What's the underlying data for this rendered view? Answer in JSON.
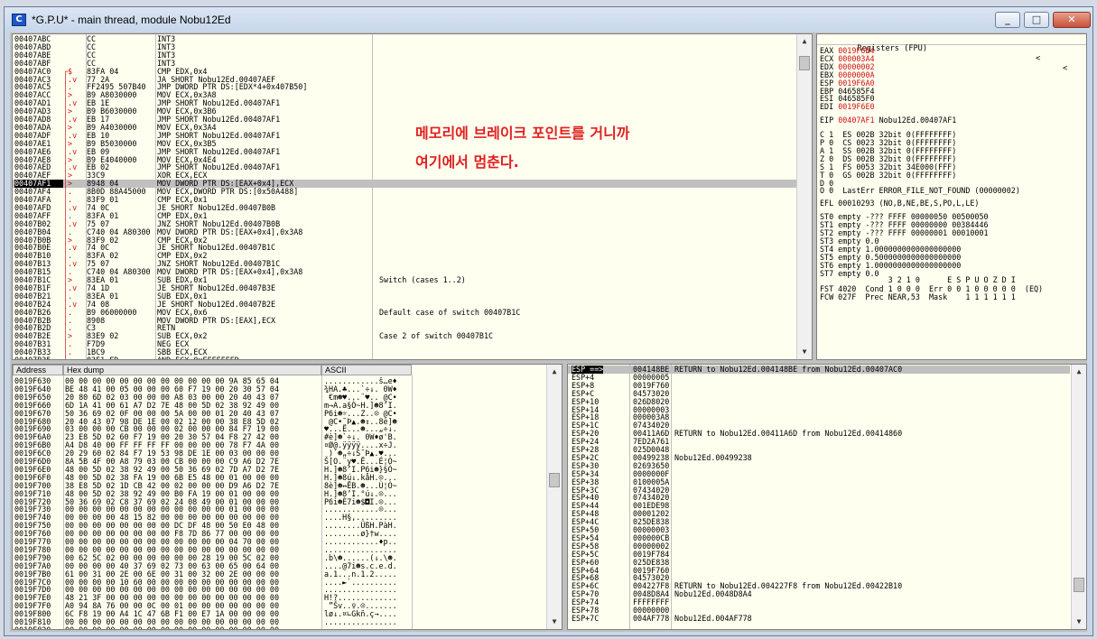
{
  "window": {
    "title": "*G.P.U* - main thread, module Nobu12Ed",
    "icon_label": "C",
    "minimize": "_",
    "maximize": "□",
    "close": "✕"
  },
  "cpu": {
    "rows": [
      {
        "addr": "00407ABC",
        "jmp": "",
        "hex": "CC",
        "asm": "INT3",
        "com": ""
      },
      {
        "addr": "00407ABD",
        "jmp": "",
        "hex": "CC",
        "asm": "INT3",
        "com": ""
      },
      {
        "addr": "00407ABE",
        "jmp": "",
        "hex": "CC",
        "asm": "INT3",
        "com": ""
      },
      {
        "addr": "00407ABF",
        "jmp": "",
        "hex": "CC",
        "asm": "INT3",
        "com": ""
      },
      {
        "addr": "00407AC0",
        "jmp": "┌$",
        "hex": "83FA 04",
        "asm": "CMP EDX,0x4",
        "com": ""
      },
      {
        "addr": "00407AC3",
        "jmp": "│.v",
        "hex": "77 2A",
        "asm": "JA SHORT Nobu12Ed.00407AEF",
        "com": ""
      },
      {
        "addr": "00407AC5",
        "jmp": "│.",
        "hex": "FF2495 507B40",
        "asm": "JMP DWORD PTR DS:[EDX*4+0x407B50]",
        "com": ""
      },
      {
        "addr": "00407ACC",
        "jmp": "│>",
        "hex": "B9 A8030000",
        "asm": "MOV ECX,0x3A8",
        "com": ""
      },
      {
        "addr": "00407AD1",
        "jmp": "│.v",
        "hex": "EB 1E",
        "asm": "JMP SHORT Nobu12Ed.00407AF1",
        "com": ""
      },
      {
        "addr": "00407AD3",
        "jmp": "│>",
        "hex": "B9 B6030000",
        "asm": "MOV ECX,0x3B6",
        "com": ""
      },
      {
        "addr": "00407AD8",
        "jmp": "│.v",
        "hex": "EB 17",
        "asm": "JMP SHORT Nobu12Ed.00407AF1",
        "com": ""
      },
      {
        "addr": "00407ADA",
        "jmp": "│>",
        "hex": "B9 A4030000",
        "asm": "MOV ECX,0x3A4",
        "com": ""
      },
      {
        "addr": "00407ADF",
        "jmp": "│.v",
        "hex": "EB 10",
        "asm": "JMP SHORT Nobu12Ed.00407AF1",
        "com": ""
      },
      {
        "addr": "00407AE1",
        "jmp": "│>",
        "hex": "B9 B5030000",
        "asm": "MOV ECX,0x3B5",
        "com": ""
      },
      {
        "addr": "00407AE6",
        "jmp": "│.v",
        "hex": "EB 09",
        "asm": "JMP SHORT Nobu12Ed.00407AF1",
        "com": ""
      },
      {
        "addr": "00407AE8",
        "jmp": "│>",
        "hex": "B9 E4040000",
        "asm": "MOV ECX,0x4E4",
        "com": ""
      },
      {
        "addr": "00407AED",
        "jmp": "│.v",
        "hex": "EB 02",
        "asm": "JMP SHORT Nobu12Ed.00407AF1",
        "com": ""
      },
      {
        "addr": "00407AEF",
        "jmp": "│>",
        "hex": "33C9",
        "asm": "XOR ECX,ECX",
        "com": ""
      },
      {
        "addr": "00407AF1",
        "jmp": "│>",
        "hex": "8948 04",
        "asm": "MOV DWORD PTR DS:[EAX+0x4],ECX",
        "com": ""
      },
      {
        "addr": "00407AF4",
        "jmp": "│.",
        "hex": "8B0D 88A45000",
        "asm": "MOV ECX,DWORD PTR DS:[0x50A488]",
        "com": ""
      },
      {
        "addr": "00407AFA",
        "jmp": "│.",
        "hex": "83F9 01",
        "asm": "CMP ECX,0x1",
        "com": ""
      },
      {
        "addr": "00407AFD",
        "jmp": "│.v",
        "hex": "74 0C",
        "asm": "JE SHORT Nobu12Ed.00407B0B",
        "com": ""
      },
      {
        "addr": "00407AFF",
        "jmp": "│.",
        "hex": "83FA 01",
        "asm": "CMP EDX,0x1",
        "com": ""
      },
      {
        "addr": "00407B02",
        "jmp": "│.v",
        "hex": "75 07",
        "asm": "JNZ SHORT Nobu12Ed.00407B0B",
        "com": ""
      },
      {
        "addr": "00407B04",
        "jmp": "│.",
        "hex": "C740 04 A80300",
        "asm": "MOV DWORD PTR DS:[EAX+0x4],0x3A8",
        "com": ""
      },
      {
        "addr": "00407B0B",
        "jmp": "│>",
        "hex": "83F9 02",
        "asm": "CMP ECX,0x2",
        "com": ""
      },
      {
        "addr": "00407B0E",
        "jmp": "│.v",
        "hex": "74 0C",
        "asm": "JE SHORT Nobu12Ed.00407B1C",
        "com": ""
      },
      {
        "addr": "00407B10",
        "jmp": "│.",
        "hex": "83FA 02",
        "asm": "CMP EDX,0x2",
        "com": ""
      },
      {
        "addr": "00407B13",
        "jmp": "│.v",
        "hex": "75 07",
        "asm": "JNZ SHORT Nobu12Ed.00407B1C",
        "com": ""
      },
      {
        "addr": "00407B15",
        "jmp": "│.",
        "hex": "C740 04 A80300",
        "asm": "MOV DWORD PTR DS:[EAX+0x4],0x3A8",
        "com": ""
      },
      {
        "addr": "00407B1C",
        "jmp": "│>",
        "hex": "83EA 01",
        "asm": "SUB EDX,0x1",
        "com": "Switch (cases 1..2)"
      },
      {
        "addr": "00407B1F",
        "jmp": "│.v",
        "hex": "74 1D",
        "asm": "JE SHORT Nobu12Ed.00407B3E",
        "com": ""
      },
      {
        "addr": "00407B21",
        "jmp": "│.",
        "hex": "83EA 01",
        "asm": "SUB EDX,0x1",
        "com": ""
      },
      {
        "addr": "00407B24",
        "jmp": "│.v",
        "hex": "74 08",
        "asm": "JE SHORT Nobu12Ed.00407B2E",
        "com": ""
      },
      {
        "addr": "00407B26",
        "jmp": "│.",
        "hex": "B9 06000000",
        "asm": "MOV ECX,0x6",
        "com": "Default case of switch 00407B1C"
      },
      {
        "addr": "00407B2B",
        "jmp": "│.",
        "hex": "8908",
        "asm": "MOV DWORD PTR DS:[EAX],ECX",
        "com": ""
      },
      {
        "addr": "00407B2D",
        "jmp": "│.",
        "hex": "C3",
        "asm": "RETN",
        "com": ""
      },
      {
        "addr": "00407B2E",
        "jmp": "│>",
        "hex": "83E9 02",
        "asm": "SUB ECX,0x2",
        "com": "Case 2 of switch 00407B1C"
      },
      {
        "addr": "00407B31",
        "jmp": "│.",
        "hex": "F7D9",
        "asm": "NEG ECX",
        "com": ""
      },
      {
        "addr": "00407B33",
        "jmp": "│.",
        "hex": "1BC9",
        "asm": "SBB ECX,ECX",
        "com": ""
      },
      {
        "addr": "00407B35",
        "jmp": "│.",
        "hex": "83E1 FD",
        "asm": "AND ECX,0xFFFFFFFD",
        "com": ""
      }
    ],
    "annotation_line1": "메모리에 브레이크 포인트를 거니까",
    "annotation_line2": "여기에서 멈춘다."
  },
  "registers": {
    "header": "Registers (FPU)",
    "nav_left": "<",
    "nav_right": "<",
    "general": [
      {
        "name": "EAX",
        "value": "0019F6B4",
        "desc": ""
      },
      {
        "name": "ECX",
        "value": "000003A4",
        "desc": ""
      },
      {
        "name": "EDX",
        "value": "00000002",
        "desc": ""
      },
      {
        "name": "EBX",
        "value": "0000000A",
        "desc": ""
      },
      {
        "name": "ESP",
        "value": "0019F6A0",
        "desc": ""
      },
      {
        "name": "EBP",
        "value": "046585F4",
        "desc": ""
      },
      {
        "name": "ESI",
        "value": "046585F0",
        "desc": ""
      },
      {
        "name": "EDI",
        "value": "0019F6E0",
        "desc": ""
      }
    ],
    "eip": {
      "name": "EIP",
      "value": "00407AF1",
      "desc": "Nobu12Ed.00407AF1"
    },
    "flags": [
      "C 1  ES 002B 32bit 0(FFFFFFFF)",
      "P 0  CS 0023 32bit 0(FFFFFFFF)",
      "A 1  SS 002B 32bit 0(FFFFFFFF)",
      "Z 0  DS 002B 32bit 0(FFFFFFFF)",
      "S 1  FS 0053 32bit 34E000(FFF)",
      "T 0  GS 002B 32bit 0(FFFFFFFF)",
      "D 0",
      "O 0  LastErr ERROR_FILE_NOT_FOUND (00000002)"
    ],
    "efl": "EFL 00010293 (NO,B,NE,BE,S,PO,L,LE)",
    "fpu": [
      "ST0 empty -??? FFFF 00000050 00500050",
      "ST1 empty -??? FFFF 00000000 00384446",
      "ST2 empty -??? FFFF 00000001 00010001",
      "ST3 empty 0.0",
      "ST4 empty 1.0000000000000000000",
      "ST5 empty 0.5000000000000000000",
      "ST6 empty 1.0000000000000000000",
      "ST7 empty 0.0"
    ],
    "fst_header": "               3 2 1 0      E S P U O Z D I",
    "fst": "FST 4020  Cond 1 0 0 0  Err 0 0 1 0 0 0 0 0  (EQ)",
    "fcw": "FCW 027F  Prec NEAR,53  Mask    1 1 1 1 1 1"
  },
  "dump": {
    "col_address": "Address",
    "col_hex": "Hex dump",
    "col_ascii": "ASCII",
    "rows": [
      {
        "addr": "0019F630",
        "hex": "00 00 00 00 00 00 00 00 00 00 00 00 9A 85 65 04",
        "asc": "............š…e♦"
      },
      {
        "addr": "0019F640",
        "hex": "BE 48 41 00 05 00 00 00 60 F7 19 00 20 30 57 04",
        "asc": "¾HA.♣...`÷↓. 0W♦"
      },
      {
        "addr": "0019F650",
        "hex": "20 80 6D 02 03 00 00 00 A8 03 00 00 20 40 43 07",
        "asc": " €m☻♥...¨♥.. @C•"
      },
      {
        "addr": "0019F660",
        "hex": "6D 1A 41 00 61 A7 D2 7E 48 00 5D 02 38 92 49 00",
        "asc": "m→A.a§Ò~H.]☻8’I."
      },
      {
        "addr": "0019F670",
        "hex": "50 36 69 02 0F 00 00 00 5A 00 00 01 20 40 43 07",
        "asc": "P6i☻☼...Z..☺ @C•"
      },
      {
        "addr": "0019F680",
        "hex": "20 40 43 07 98 DE 1E 00 02 12 00 00 38 E8 5D 02",
        "asc": " @C•˜Þ▲.☻↕..8è]☻"
      },
      {
        "addr": "0019F690",
        "hex": "03 00 00 00 CB 00 00 00 02 00 00 00 84 F7 19 00",
        "asc": "♥...Ë...☻...„÷↓."
      },
      {
        "addr": "0019F6A0",
        "hex": "23 E8 5D 02 60 F7 19 00 20 30 57 04 F8 27 42 00",
        "asc": "#è]☻`÷↓. 0W♦ø'B."
      },
      {
        "addr": "0019F6B0",
        "hex": "A4 D8 40 00 FF FF FF FF 00 00 00 00 78 F7 4A 00",
        "asc": "¤Ø@.ÿÿÿÿ....x÷J."
      },
      {
        "addr": "0019F6C0",
        "hex": "20 29 60 02 84 F7 19 53 98 DE 1E 00 03 00 00 00",
        "asc": " )`☻„÷↓S˜Þ▲.♥..."
      },
      {
        "addr": "0019F6D0",
        "hex": "8A 5B 4F 00 A8 79 03 00 CB 00 00 00 C9 A6 D2 7E",
        "asc": "Š[O.¨y♥.Ë...É¦Ò~"
      },
      {
        "addr": "0019F6E0",
        "hex": "48 00 5D 02 38 92 49 00 50 36 69 02 7D A7 D2 7E",
        "asc": "H.]☻8’I.P6i☻}§Ò~"
      },
      {
        "addr": "0019F6F0",
        "hex": "48 00 5D 02 38 FA 19 00 6B E5 48 00 01 00 00 00",
        "asc": "H.]☻8ú↓.kåH.☺..."
      },
      {
        "addr": "0019F700",
        "hex": "38 E8 5D 02 1D CB 42 00 02 00 00 00 D9 A6 D2 7E",
        "asc": "8è]☻↔ËB.☻...Ù¦Ò~"
      },
      {
        "addr": "0019F710",
        "hex": "48 00 5D 02 38 92 49 00 B0 FA 19 00 01 00 00 00",
        "asc": "H.]☻8’I.°ú↓.☺..."
      },
      {
        "addr": "0019F720",
        "hex": "50 36 69 02 C8 37 69 02 24 08 49 00 01 00 00 00",
        "asc": "P6i☻È7i☻$◘I.☺..."
      },
      {
        "addr": "0019F730",
        "hex": "00 00 00 00 00 00 00 00 00 00 00 00 01 00 00 00",
        "asc": "............☺..."
      },
      {
        "addr": "0019F740",
        "hex": "00 00 00 00 48 15 82 00 00 00 00 00 00 00 00 00",
        "asc": "....H§‚........."
      },
      {
        "addr": "0019F750",
        "hex": "00 00 00 00 00 00 00 00 DC DF 48 00 50 E0 48 00",
        "asc": "........ÜßH.PàH."
      },
      {
        "addr": "0019F760",
        "hex": "00 00 00 00 00 00 00 00 F8 7D 86 77 00 00 00 00",
        "asc": "........ø}†w...."
      },
      {
        "addr": "0019F770",
        "hex": "00 00 00 00 00 00 00 00 00 00 00 00 04 70 00 00",
        "asc": "............♦p.."
      },
      {
        "addr": "0019F780",
        "hex": "00 00 00 00 00 00 00 00 00 00 00 00 00 00 00 00",
        "asc": "................"
      },
      {
        "addr": "0019F790",
        "hex": "00 62 5C 02 00 00 00 00 00 00 28 19 00 5C 02 00",
        "asc": ".b\\☻......(↓.\\☻."
      },
      {
        "addr": "0019F7A0",
        "hex": "00 00 00 00 40 37 69 02 73 00 63 00 65 00 64 00",
        "asc": "....@7i☻s.c.e.d."
      },
      {
        "addr": "0019F7B0",
        "hex": "61 00 31 00 2E 00 6E 00 31 00 32 00 2E 00 00 00",
        "asc": "a.1...n.1.2....."
      },
      {
        "addr": "0019F7C0",
        "hex": "00 00 00 00 10 60 00 00 00 00 00 00 00 00 00 00",
        "asc": "....►`.........."
      },
      {
        "addr": "0019F7D0",
        "hex": "00 00 00 00 00 00 00 00 00 00 00 00 00 00 00 00",
        "asc": "................"
      },
      {
        "addr": "0019F7E0",
        "hex": "48 21 3F 00 00 00 00 00 00 00 00 00 00 00 00 00",
        "asc": "H!?............."
      },
      {
        "addr": "0019F7F0",
        "hex": "A0 94 8A 76 00 00 0C 00 01 00 00 00 00 00 00 00",
        "asc": " ”Šv..♀.☺......."
      },
      {
        "addr": "0019F800",
        "hex": "6C F8 19 00 A4 1C 47 6B F1 00 E7 1A 00 00 00 00",
        "asc": "lø↓.¤∟Gkñ.ç→...."
      },
      {
        "addr": "0019F810",
        "hex": "00 00 00 00 00 00 00 00 00 00 00 00 00 00 00 00",
        "asc": "................"
      },
      {
        "addr": "0019F820",
        "hex": "00 00 00 00 00 00 00 00 00 00 00 00 00 00 00 00",
        "asc": "................"
      },
      {
        "addr": "0019F830",
        "hex": "06 95 8D 76 00 00 00 00 00 00 00 00 00 00 00 00",
        "asc": "♠•.v............"
      }
    ]
  },
  "stack": {
    "rows": [
      {
        "addr": "ESP ==>",
        "val": "004148BE",
        "com": "RETURN to Nobu12Ed.004148BE from Nobu12Ed.00407AC0"
      },
      {
        "addr": "ESP+4",
        "val": "00000005",
        "com": ""
      },
      {
        "addr": "ESP+8",
        "val": "0019F760",
        "com": ""
      },
      {
        "addr": "ESP+C",
        "val": "04573020",
        "com": ""
      },
      {
        "addr": "ESP+10",
        "val": "026D8020",
        "com": ""
      },
      {
        "addr": "ESP+14",
        "val": "00000003",
        "com": ""
      },
      {
        "addr": "ESP+18",
        "val": "000003A8",
        "com": ""
      },
      {
        "addr": "ESP+1C",
        "val": "07434020",
        "com": ""
      },
      {
        "addr": "ESP+20",
        "val": "00411A6D",
        "com": "RETURN to Nobu12Ed.00411A6D from Nobu12Ed.00414860"
      },
      {
        "addr": "ESP+24",
        "val": "7ED2A761",
        "com": ""
      },
      {
        "addr": "ESP+28",
        "val": "025D0048",
        "com": ""
      },
      {
        "addr": "ESP+2C",
        "val": "00499238",
        "com": "Nobu12Ed.00499238"
      },
      {
        "addr": "ESP+30",
        "val": "02693650",
        "com": ""
      },
      {
        "addr": "ESP+34",
        "val": "0000000F",
        "com": ""
      },
      {
        "addr": "ESP+38",
        "val": "0100005A",
        "com": ""
      },
      {
        "addr": "ESP+3C",
        "val": "07434020",
        "com": ""
      },
      {
        "addr": "ESP+40",
        "val": "07434020",
        "com": ""
      },
      {
        "addr": "ESP+44",
        "val": "001EDE98",
        "com": ""
      },
      {
        "addr": "ESP+48",
        "val": "00001202",
        "com": ""
      },
      {
        "addr": "ESP+4C",
        "val": "025DE838",
        "com": ""
      },
      {
        "addr": "ESP+50",
        "val": "00000003",
        "com": ""
      },
      {
        "addr": "ESP+54",
        "val": "000000CB",
        "com": ""
      },
      {
        "addr": "ESP+58",
        "val": "00000002",
        "com": ""
      },
      {
        "addr": "ESP+5C",
        "val": "0019F784",
        "com": ""
      },
      {
        "addr": "ESP+60",
        "val": "025DE838",
        "com": ""
      },
      {
        "addr": "ESP+64",
        "val": "0019F760",
        "com": ""
      },
      {
        "addr": "ESP+68",
        "val": "04573020",
        "com": ""
      },
      {
        "addr": "ESP+6C",
        "val": "004227F8",
        "com": "RETURN to Nobu12Ed.004227F8 from Nobu12Ed.00422B10"
      },
      {
        "addr": "ESP+70",
        "val": "0048D8A4",
        "com": "Nobu12Ed.0048D8A4"
      },
      {
        "addr": "ESP+74",
        "val": "FFFFFFFF",
        "com": ""
      },
      {
        "addr": "ESP+78",
        "val": "00000000",
        "com": ""
      },
      {
        "addr": "ESP+7C",
        "val": "004AF778",
        "com": "Nobu12Ed.004AF778"
      }
    ]
  }
}
